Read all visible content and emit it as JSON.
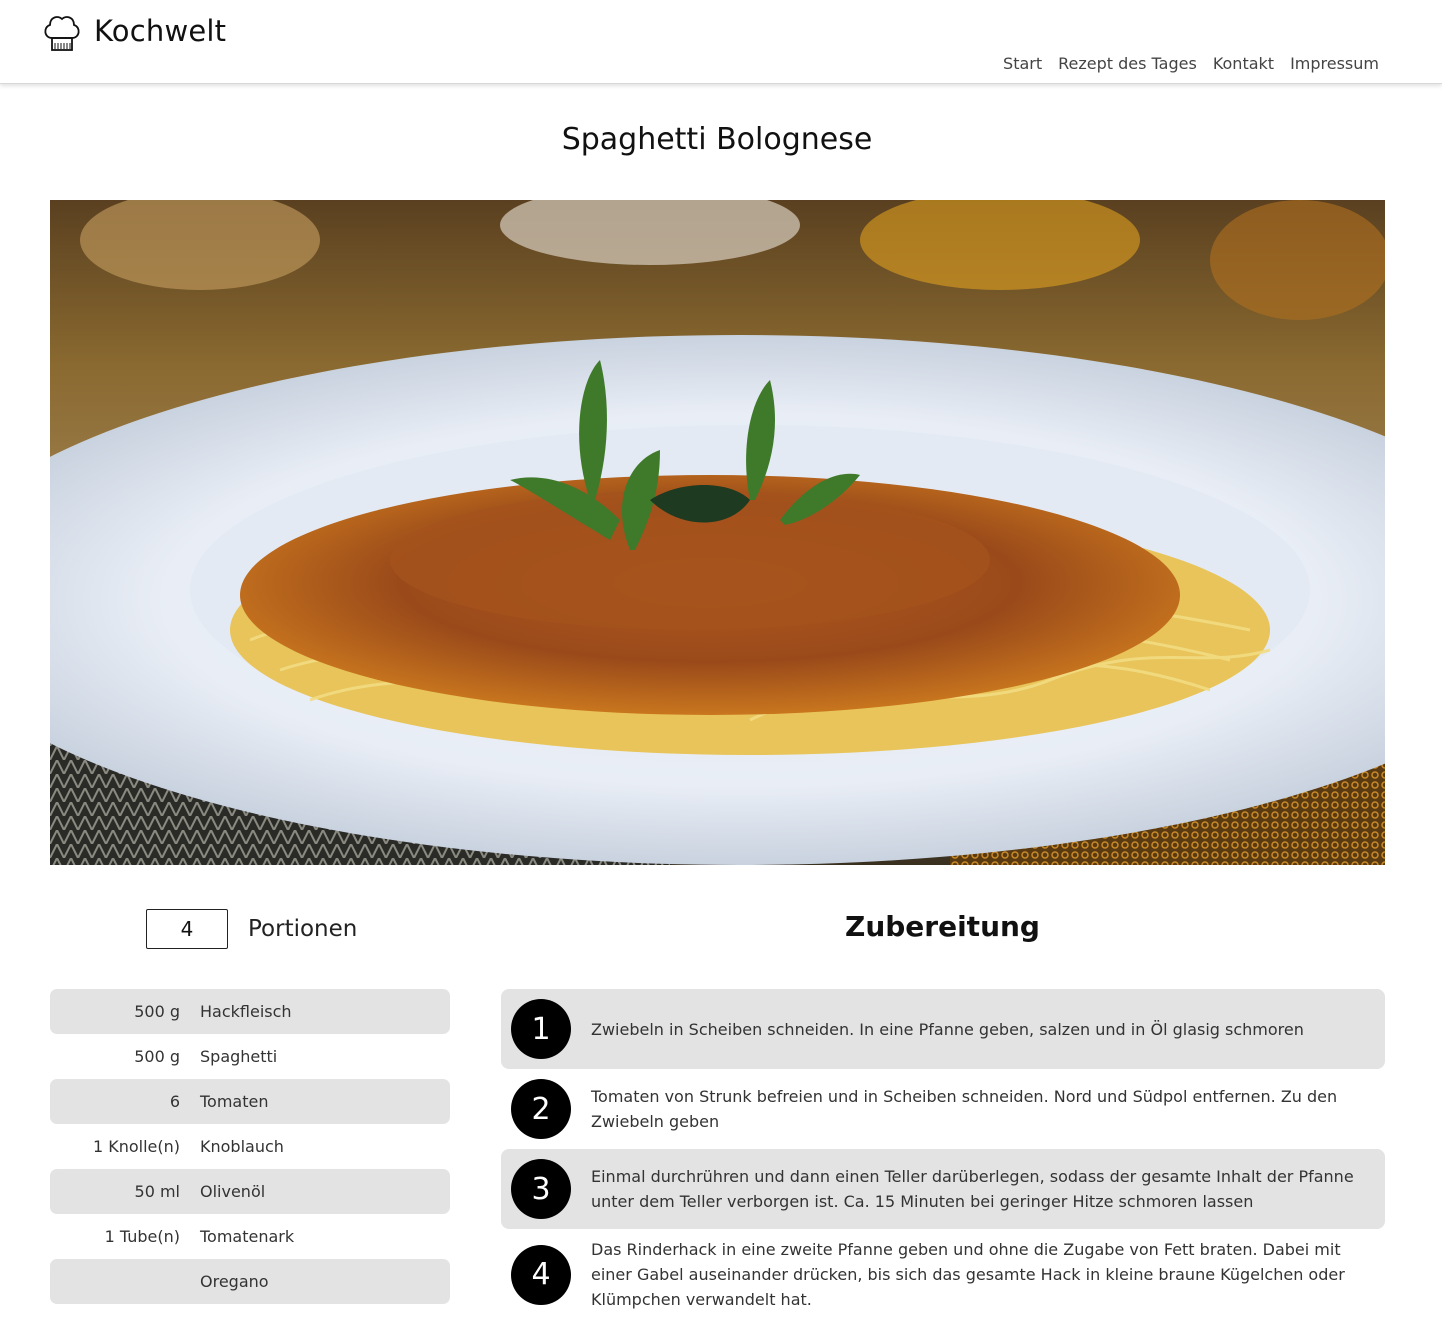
{
  "header": {
    "brand": "Kochwelt",
    "logo_icon": "chef-hat-icon",
    "nav": [
      "Start",
      "Rezept des Tages",
      "Kontakt",
      "Impressum"
    ]
  },
  "recipe": {
    "title": "Spaghetti Bolognese",
    "servings_value": "4",
    "servings_label": "Portionen",
    "steps_title": "Zubereitung",
    "ingredients": [
      {
        "amount": "500 g",
        "name": "Hackfleisch"
      },
      {
        "amount": "500 g",
        "name": "Spaghetti"
      },
      {
        "amount": "6",
        "name": "Tomaten"
      },
      {
        "amount": "1 Knolle(n)",
        "name": "Knoblauch"
      },
      {
        "amount": "50 ml",
        "name": "Olivenöl"
      },
      {
        "amount": "1 Tube(n)",
        "name": "Tomatenark"
      },
      {
        "amount": "",
        "name": "Oregano"
      }
    ],
    "steps": [
      {
        "number": "1",
        "text": "Zwiebeln in Scheiben schneiden. In eine Pfanne geben, salzen und in Öl glasig schmoren"
      },
      {
        "number": "2",
        "text": "Tomaten von Strunk befreien und in Scheiben schneiden. Nord und Südpol entfernen. Zu den Zwiebeln geben"
      },
      {
        "number": "3",
        "text": "Einmal durchrühren und dann einen Teller darüberlegen, sodass der gesamte Inhalt der Pfanne unter dem Teller verborgen ist. Ca. 15 Minuten bei geringer Hitze schmoren lassen"
      },
      {
        "number": "4",
        "text": "Das Rinderhack in eine zweite Pfanne geben und ohne die Zugabe von Fett braten. Dabei mit einer Gabel auseinander drücken, bis sich das gesamte Hack in kleine braune Kügelchen oder Klümpchen verwandelt hat."
      }
    ]
  },
  "colors": {
    "row_gray": "#e3e3e3",
    "step_badge": "#000000",
    "text": "#333333"
  }
}
